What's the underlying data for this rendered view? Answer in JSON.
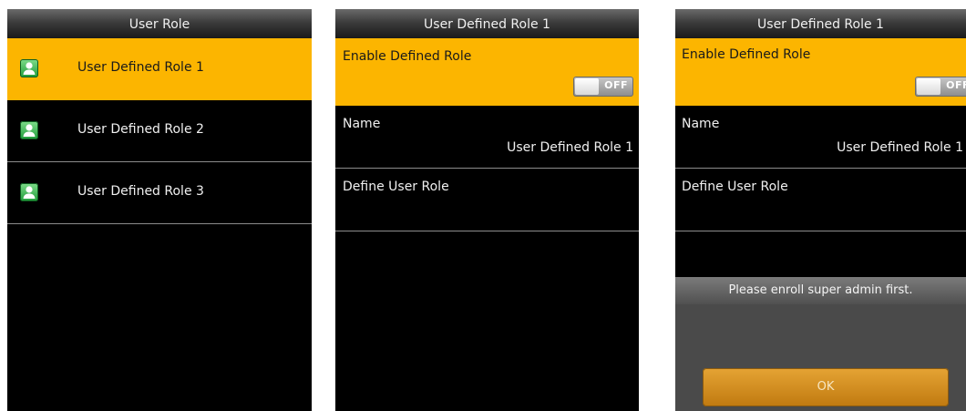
{
  "screen1": {
    "title": "User Role",
    "items": [
      {
        "label": "User Defined Role 1",
        "selected": true
      },
      {
        "label": "User Defined Role 2",
        "selected": false
      },
      {
        "label": "User Defined Role 3",
        "selected": false
      }
    ]
  },
  "screen2": {
    "title": "User Defined Role 1",
    "enable_label": "Enable Defined Role",
    "toggle_text": "OFF",
    "name_label": "Name",
    "name_value": "User Defined Role 1",
    "define_label": "Define User Role"
  },
  "screen3": {
    "title": "User Defined Role 1",
    "enable_label": "Enable Defined Role",
    "toggle_text": "OFF",
    "name_label": "Name",
    "name_value": "User Defined Role 1",
    "define_label": "Define User Role",
    "dialog": {
      "message": "Please enroll super admin first.",
      "ok_label": "OK"
    }
  },
  "colors": {
    "highlight": "#fcb500",
    "background": "#000000",
    "separator": "#8c8c8c",
    "ok_button": "#d8921e"
  },
  "icons": {
    "role_item": "user-icon"
  }
}
